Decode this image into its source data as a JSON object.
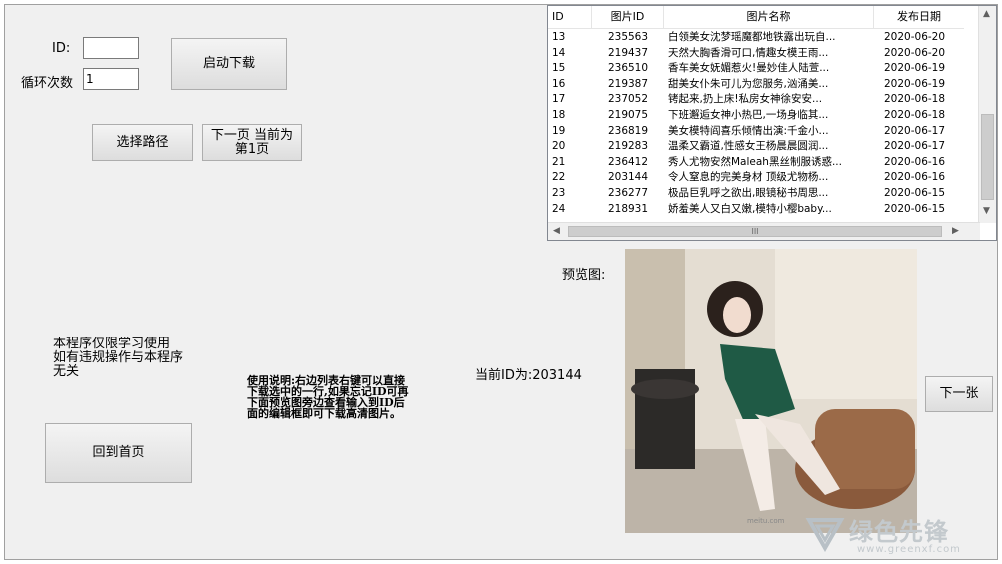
{
  "form": {
    "id_label": "ID:",
    "id_value": "",
    "loop_label": "循环次数",
    "loop_value": "1",
    "start_button": "启动下载",
    "choose_path_button": "选择路径",
    "next_page_line1": "下一页 当前为",
    "next_page_line2": "第1页",
    "home_button": "回到首页",
    "next_image_button": "下一张",
    "preview_label": "预览图:",
    "current_id_label": "当前ID为:",
    "current_id_value": "203144",
    "disclaimer_line1": "本程序仅限学习使用",
    "disclaimer_line2": "如有违规操作与本程序",
    "disclaimer_line3": "无关",
    "usage_note": "使用说明:右边列表右键可以直接下载选中的一行,如果忘记ID可再下面预览图旁边查看输入到ID后面的编辑框即可下载高清图片。"
  },
  "list": {
    "headers": [
      "ID",
      "图片ID",
      "图片名称",
      "发布日期"
    ],
    "rows": [
      [
        "13",
        "235563",
        "白领美女沈梦瑶魔都地铁露出玩自...",
        "2020-06-20"
      ],
      [
        "14",
        "219437",
        "天然大胸香滑可口,情趣女模王雨...",
        "2020-06-20"
      ],
      [
        "15",
        "236510",
        "香车美女妩媚惹火!曼妙佳人陆萱...",
        "2020-06-19"
      ],
      [
        "16",
        "219387",
        "甜美女仆朱可儿为您服务,汹涌美...",
        "2020-06-19"
      ],
      [
        "17",
        "237052",
        "铐起来,扔上床!私房女神徐安安...",
        "2020-06-18"
      ],
      [
        "18",
        "219075",
        "下班邂逅女神小热巴,一场身临其...",
        "2020-06-18"
      ],
      [
        "19",
        "236819",
        "美女模特阎喜乐倾情出演:千金小...",
        "2020-06-17"
      ],
      [
        "20",
        "219283",
        "温柔又霸道,性感女王杨晨晨圆润...",
        "2020-06-17"
      ],
      [
        "21",
        "236412",
        "秀人尤物安然Maleah黑丝制服诱惑...",
        "2020-06-16"
      ],
      [
        "22",
        "203144",
        " 令人窒息的完美身材 顶级尤物杨...",
        "2020-06-16"
      ],
      [
        "23",
        "236277",
        "极品巨乳呼之欲出,眼镜秘书周思...",
        "2020-06-15"
      ],
      [
        "24",
        "218931",
        "娇羞美人又白又嫩,模特小樱baby...",
        "2020-06-15"
      ]
    ],
    "hscroll_grip": "III"
  },
  "watermark": {
    "brand": "绿色先锋",
    "url": "www.greenxf.com",
    "small": "meitu.com"
  },
  "colors": {
    "window_bg": "#f0f0f0",
    "list_bg": "#ffffff"
  }
}
